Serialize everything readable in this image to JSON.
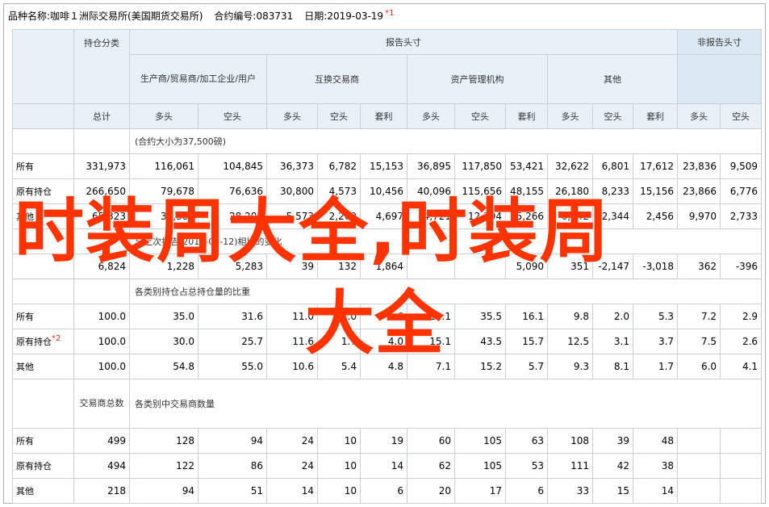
{
  "title": {
    "label_name": "品种名称:",
    "name": "咖啡１洲际交易所(美国期货交易所)",
    "label_code": "合约编号:",
    "code": "083731",
    "label_date": "日期:",
    "date": "2019-03-19",
    "note": "*1"
  },
  "header": {
    "reported": "报告头寸",
    "nonreported": "非报告头寸",
    "category": "持仓分类",
    "producer": "生产商/贸易商/加工企业/用户",
    "swap": "互换交易商",
    "managed": "资产管理机构",
    "other": "其他",
    "total": "总计",
    "long": "多头",
    "short": "空头",
    "spread": "套利"
  },
  "section1": {
    "title": "(合约大小为37,500磅)",
    "rows": [
      {
        "label": "所有",
        "values": [
          "331,973",
          "116,061",
          "104,845",
          "36,373",
          "6,782",
          "15,153",
          "36,895",
          "117,850",
          "53,421",
          "32,622",
          "6,801",
          "17,612",
          "23,836",
          "9,509"
        ]
      },
      {
        "label": "原有持仓",
        "values": [
          "266,650",
          "79,678",
          "76,636",
          "30,800",
          "4,573",
          "10,456",
          "40,096",
          "115,656",
          "48,155",
          "26,180",
          "8,233",
          "15,156",
          "23,866",
          "6,776"
        ]
      },
      {
        "label": "其他",
        "values": [
          "65,323",
          "36,383",
          "28,209",
          "5,573",
          "2,209",
          "4,697",
          "4,721",
          "12,194",
          "5,266",
          "6,442",
          "2,344",
          "2,456",
          "9,970",
          "2,733"
        ]
      }
    ]
  },
  "section2": {
    "title": "与上次报告(2019-03-12)相比的变化",
    "values": [
      "6,824",
      "1,228",
      "5,283",
      "39",
      "132",
      "1,864",
      "",
      "",
      "5,090",
      "351",
      "-2,147",
      "-3,018",
      "362",
      "-396"
    ]
  },
  "section3": {
    "title": "各类别持仓占总持仓量的比重",
    "rows": [
      {
        "label": "所有",
        "note": "",
        "values": [
          "100.0",
          "35.0",
          "31.6",
          "11.0",
          "2.0",
          "4.6",
          "11.1",
          "35.5",
          "16.1",
          "9.8",
          "2.0",
          "5.3",
          "7.2",
          "2.9"
        ]
      },
      {
        "label": "原有持仓",
        "note": "*2",
        "values": [
          "100.0",
          "30.0",
          "25.7",
          "11.6",
          "1.7",
          "4.0",
          "15.1",
          "43.5",
          "15.7",
          "12.5",
          "3.1",
          "3.7",
          "7.5",
          "2.6"
        ]
      },
      {
        "label": "其他",
        "note": "",
        "values": [
          "100.0",
          "54.8",
          "55.0",
          "10.6",
          "5.4",
          "4.8",
          "7.1",
          "15.2",
          "5.7",
          "9.3",
          "8.1",
          "1.7",
          "6.0",
          "4.1"
        ]
      }
    ]
  },
  "section4": {
    "title_total": "交易商总数",
    "title": "各类别中交易商数量",
    "rows": [
      {
        "label": "所有",
        "values": [
          "499",
          "128",
          "94",
          "24",
          "10",
          "19",
          "60",
          "105",
          "63",
          "108",
          "39",
          "48",
          "",
          ""
        ]
      },
      {
        "label": "原有持仓",
        "values": [
          "494",
          "122",
          "86",
          "24",
          "10",
          "14",
          "62",
          "105",
          "53",
          "111",
          "42",
          "38",
          "",
          ""
        ]
      },
      {
        "label": "其他",
        "values": [
          "218",
          "94",
          "51",
          "14",
          "10",
          "6",
          "20",
          "17",
          "6",
          "33",
          "15",
          "14",
          "",
          ""
        ]
      }
    ]
  },
  "watermark": {
    "line1": "时装周大全,时装周",
    "line2": "大全"
  },
  "colors": {
    "header_bg": "#e8f1f8",
    "border": "#c8d0d8",
    "watermark": "#ff3300",
    "note": "#e0301e"
  }
}
